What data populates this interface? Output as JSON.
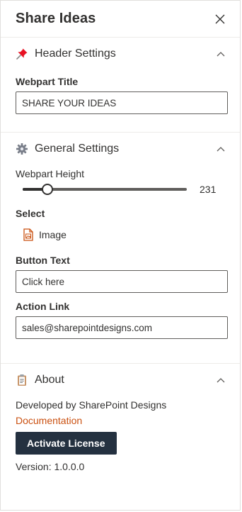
{
  "pane": {
    "title": "Share Ideas"
  },
  "header_settings": {
    "title": "Header Settings",
    "webpart_title_label": "Webpart Title",
    "webpart_title_value": "SHARE YOUR IDEAS"
  },
  "general_settings": {
    "title": "General Settings",
    "height_label": "Webpart Height",
    "height_value": "231",
    "height_fraction": 0.15,
    "select_label": "Select",
    "select_option": "Image",
    "button_text_label": "Button Text",
    "button_text_value": "Click here",
    "action_link_label": "Action Link",
    "action_link_value": "sales@sharepointdesigns.com"
  },
  "about": {
    "title": "About",
    "developed_by": "Developed by SharePoint Designs",
    "documentation_link": "Documentation",
    "activate_button": "Activate License",
    "version": "Version: 1.0.0.0"
  },
  "colors": {
    "link": "#ca5010",
    "button_bg": "#243140",
    "pin": "#e81123"
  }
}
